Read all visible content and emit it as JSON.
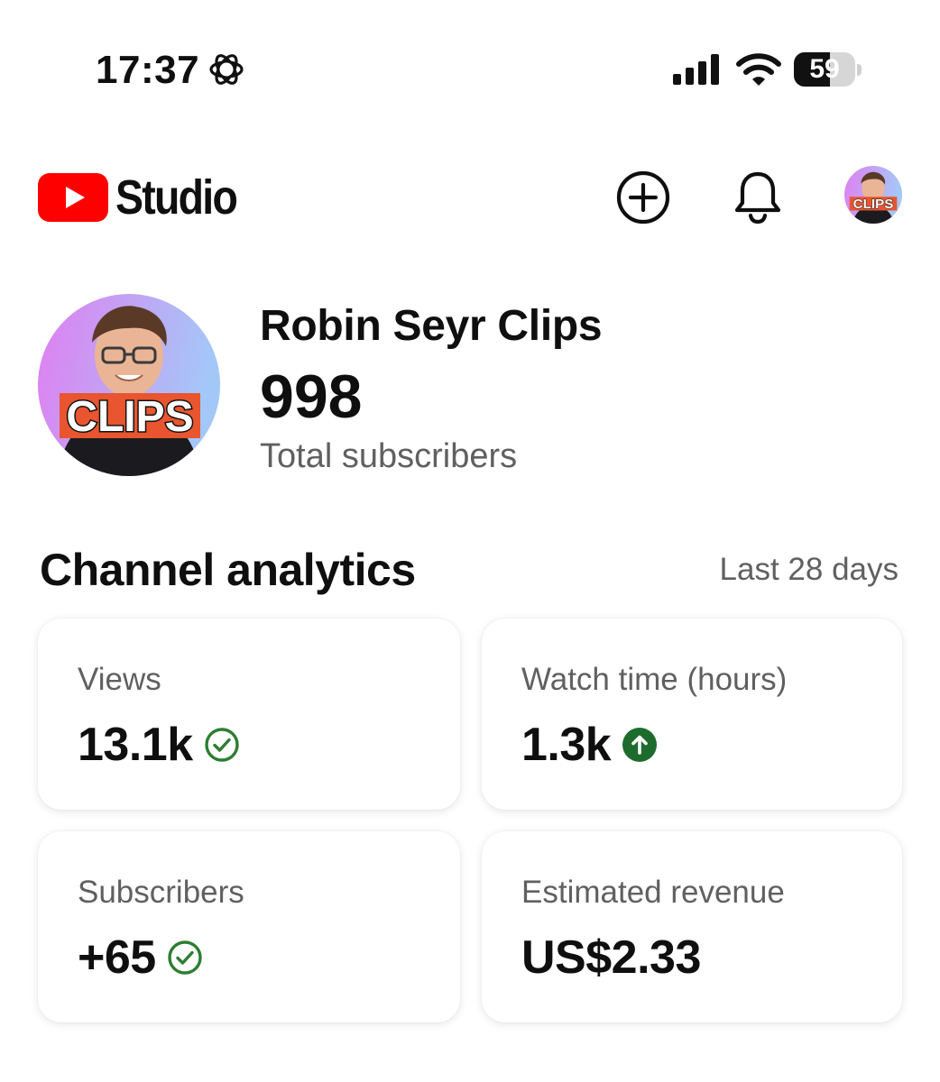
{
  "status_bar": {
    "time": "17:37",
    "battery_percent": 59,
    "battery_label": "59",
    "icons": [
      "focus-mode-icon",
      "cellular-signal-icon",
      "wifi-icon",
      "battery-icon"
    ]
  },
  "header": {
    "logo_text": "Studio",
    "brand_color": "#ff0000",
    "actions": [
      "create-icon",
      "bell-icon",
      "account-avatar"
    ]
  },
  "channel": {
    "name": "Robin Seyr Clips",
    "subscribers": "998",
    "subscribers_caption": "Total subscribers",
    "avatar_badge": "CLIPS"
  },
  "analytics": {
    "title": "Channel analytics",
    "period": "Last 28 days",
    "cards": [
      {
        "label": "Views",
        "value": "13.1k",
        "status_icon": "check-circle-icon",
        "status_color": "#2e7d32"
      },
      {
        "label": "Watch time (hours)",
        "value": "1.3k",
        "status_icon": "arrow-up-circle-icon",
        "status_color": "#1e6b2e"
      },
      {
        "label": "Subscribers",
        "value": "+65",
        "status_icon": "check-circle-icon",
        "status_color": "#2e7d32"
      },
      {
        "label": "Estimated revenue",
        "value": "US$2.33",
        "status_icon": "",
        "status_color": ""
      }
    ]
  }
}
